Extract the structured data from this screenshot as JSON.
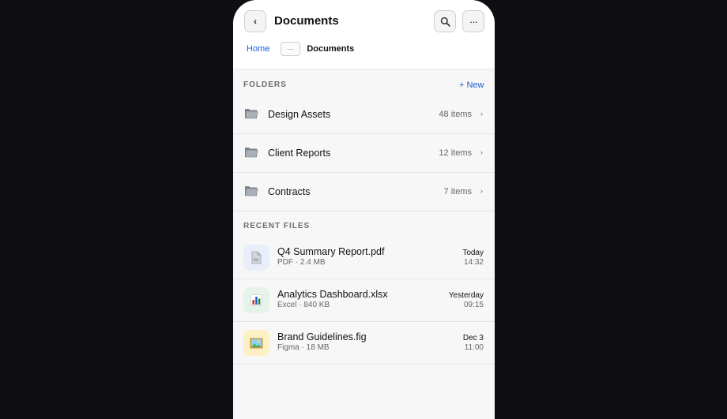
{
  "header": {
    "back_glyph": "‹",
    "title": "Documents",
    "search_glyph": "🔍",
    "more_glyph": "···"
  },
  "breadcrumb": {
    "home": "Home",
    "more_glyph": "···",
    "current": "Documents"
  },
  "folders_section": {
    "label": "FOLDERS",
    "new_label": "+ New",
    "items": [
      {
        "name": "Design Assets",
        "count": "48 items",
        "icon": "folder-icon"
      },
      {
        "name": "Client Reports",
        "count": "12 items",
        "icon": "folder-icon"
      },
      {
        "name": "Contracts",
        "count": "7 items",
        "icon": "folder-icon"
      }
    ]
  },
  "recent_section": {
    "label": "RECENT FILES",
    "items": [
      {
        "name": "Q4 Summary Report.pdf",
        "meta": "PDF · 2.4 MB",
        "date": "Today",
        "time": "14:32",
        "icon": "pdf-file-icon",
        "tile_color": "#e9eefb"
      },
      {
        "name": "Analytics Dashboard.xlsx",
        "meta": "Excel · 840 KB",
        "date": "Yesterday",
        "time": "09:15",
        "icon": "bar-chart-icon",
        "tile_color": "#e6f3e8"
      },
      {
        "name": "Brand Guidelines.fig",
        "meta": "Figma · 18 MB",
        "date": "Dec 3",
        "time": "11:00",
        "icon": "framed-picture-icon",
        "tile_color": "#fdf0c4"
      }
    ]
  },
  "colors": {
    "accent": "#1a5fd6",
    "background": "#0f0f13",
    "surface": "#f7f7f7"
  }
}
